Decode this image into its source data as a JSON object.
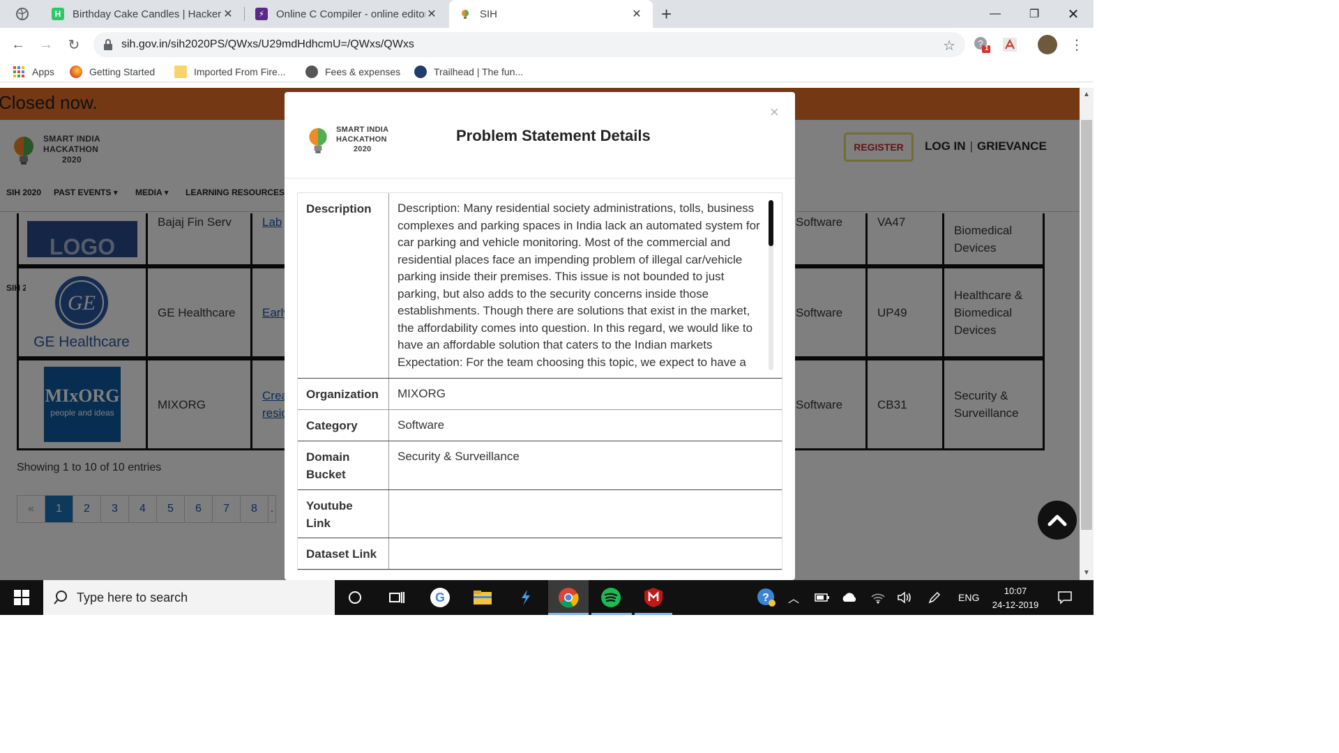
{
  "browser": {
    "tabs": [
      {
        "title": "Birthday Cake Candles | HackerRa",
        "icon": "hackerrank-icon"
      },
      {
        "title": "Online C Compiler - online editor",
        "icon": "onlinegdb-icon"
      },
      {
        "title": "SIH",
        "icon": "sih-bulb-icon"
      }
    ],
    "new_tab": "+",
    "url": "sih.gov.in/sih2020PS/QWxs/U29mdHdhcmU=/QWxs/QWxs",
    "extension_badge": "1",
    "bookmarks": [
      "Apps",
      "Getting Started",
      "Imported From Fire...",
      "Fees & expenses",
      "Trailhead | The fun..."
    ]
  },
  "site": {
    "banner": "Closed now.",
    "brand": {
      "line1": "SMART INDIA",
      "line2": "HACKATHON",
      "line3": "2020"
    },
    "register": "REGISTER",
    "login": "LOG IN",
    "divider": "|",
    "grievance": "GRIEVANCE",
    "nav": [
      "SIH 2020",
      "PAST EVENTS",
      "MEDIA",
      "LEARNING RESOURCES"
    ],
    "rows": [
      {
        "logo": "LOGO",
        "org": "Bajaj Fin Serv",
        "title": "Lab",
        "category": "Software",
        "id": "VA47",
        "domain": "Biomedical Devices"
      },
      {
        "logo": "GE Healthcare",
        "org": "GE Healthcare",
        "title": "Early",
        "category": "Software",
        "id": "UP49",
        "domain": "Healthcare & Biomedical Devices"
      },
      {
        "logo": "MIxORG",
        "logo_sub": "people and ideas",
        "org": "MIXORG",
        "title": "Crea the c resid",
        "category": "Software",
        "id": "CB31",
        "domain": "Security & Surveillance"
      }
    ],
    "showing": "Showing 1 to 10 of 10 entries",
    "pages": [
      "«",
      "1",
      "2",
      "3",
      "4",
      "5",
      "6",
      "7",
      "8",
      "."
    ]
  },
  "modal": {
    "brand": {
      "line1": "SMART INDIA",
      "line2": "HACKATHON",
      "line3": "2020"
    },
    "title": "Problem Statement Details",
    "close": "×",
    "labels": {
      "description": "Description",
      "organization": "Organization",
      "category": "Category",
      "domain": "Domain Bucket",
      "youtube": "Youtube Link",
      "dataset": "Dataset Link"
    },
    "description": "Description: Many residential society administrations, tolls, business complexes and parking spaces in India lack an automated system for car parking and vehicle monitoring. Most of the commercial and residential places face an impending problem of illegal car/vehicle parking inside their premises. This issue is not bounded to just parking, but also adds to the security concerns inside those establishments. Though there are solutions that exist in the market, the affordability comes into question. In this regard, we would like to have an affordable solution that caters to the Indian markets Expectation: For the team choosing this topic, we expect to have a",
    "organization": "MIXORG",
    "category": "Software",
    "domain": "Security & Surveillance",
    "youtube": "",
    "dataset": ""
  },
  "taskbar": {
    "search_placeholder": "Type here to search",
    "language": "ENG",
    "time": "10:07",
    "date": "24-12-2019"
  }
}
